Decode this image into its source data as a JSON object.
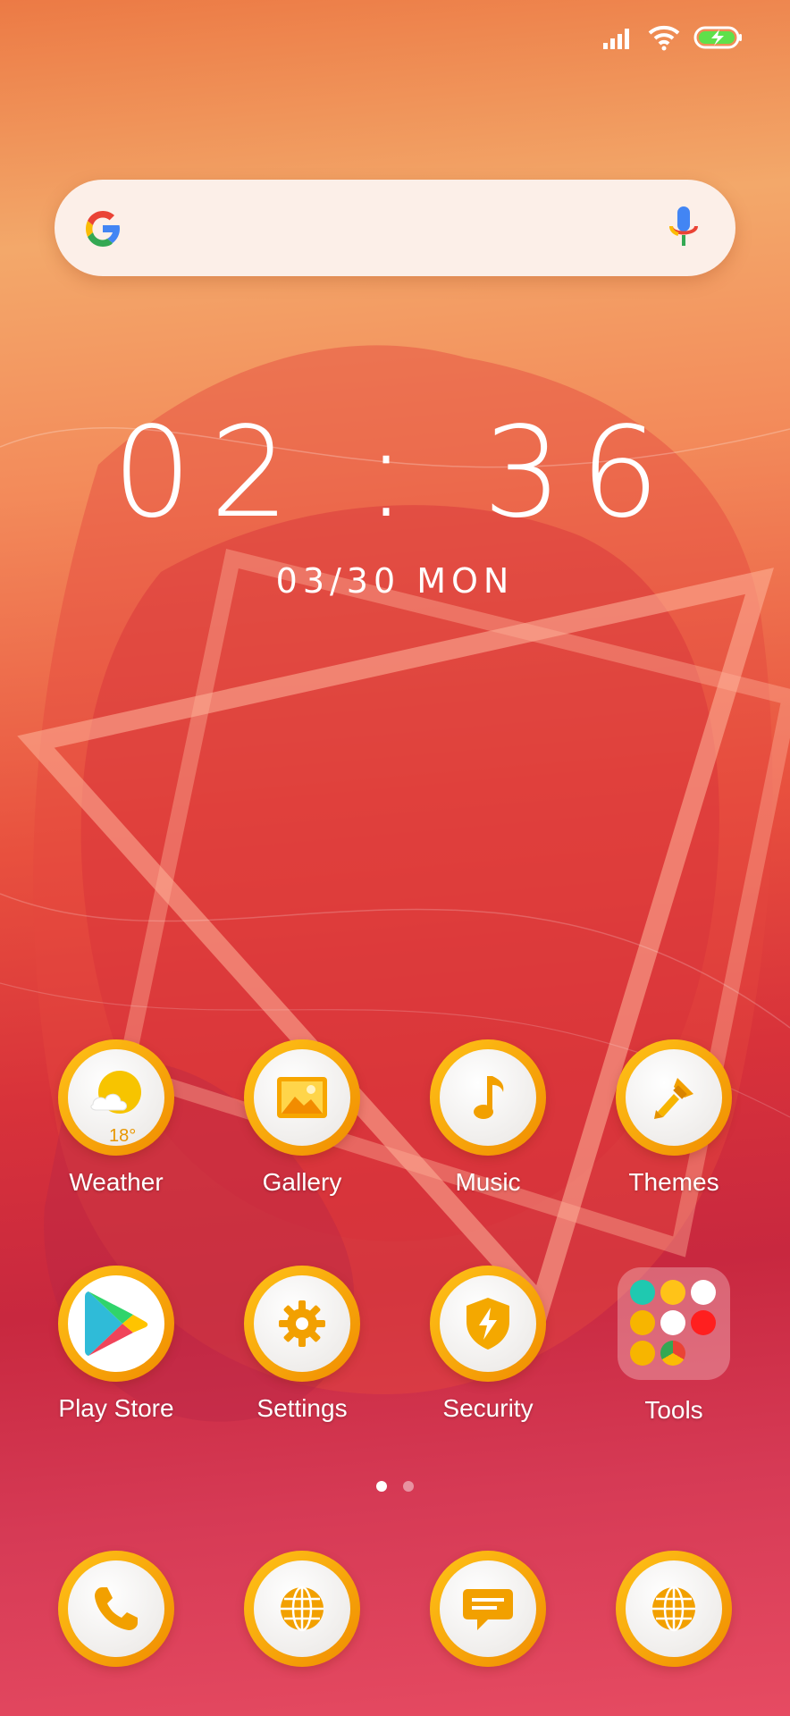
{
  "search": {
    "placeholder": ""
  },
  "clock": {
    "time": "02 : 36",
    "date": "03/30 MON"
  },
  "apps_row1": [
    {
      "label": "Weather",
      "icon": "weather-icon",
      "temp": "18°"
    },
    {
      "label": "Gallery",
      "icon": "gallery-icon"
    },
    {
      "label": "Music",
      "icon": "music-note-icon"
    },
    {
      "label": "Themes",
      "icon": "paintbrush-icon"
    }
  ],
  "apps_row2": [
    {
      "label": "Play Store",
      "icon": "play-store-icon"
    },
    {
      "label": "Settings",
      "icon": "gear-icon"
    },
    {
      "label": "Security",
      "icon": "shield-icon"
    },
    {
      "label": "Tools",
      "icon": "folder-icon"
    }
  ],
  "dock": [
    {
      "icon": "phone-icon"
    },
    {
      "icon": "globe-icon"
    },
    {
      "icon": "message-icon"
    },
    {
      "icon": "globe-icon"
    }
  ],
  "pages": {
    "count": 2,
    "active": 1
  },
  "colors": {
    "ring_start": "#ffc318",
    "ring_end": "#f08c00",
    "accent": "#f5a800"
  }
}
